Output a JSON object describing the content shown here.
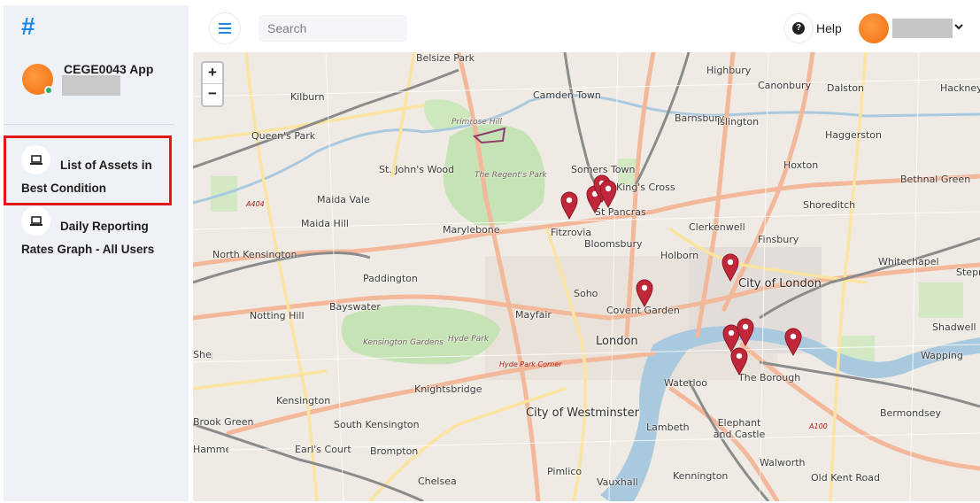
{
  "app": {
    "logo_glyph": "#",
    "title": "CEGE0043 App",
    "brand_color": "#1e88e5",
    "avatar_color": "#f57c1f",
    "status_color": "#27ae60"
  },
  "sidebar": {
    "items": [
      {
        "label": "List of Assets in Best Condition",
        "icon": "laptop-icon",
        "highlighted": true
      },
      {
        "label": "Daily Reporting Rates Graph - All Users",
        "icon": "laptop-icon",
        "highlighted": false
      }
    ],
    "highlight_color": "#e0181b"
  },
  "header": {
    "menu_icon": "hamburger-icon",
    "search": {
      "placeholder": "Search",
      "value": ""
    },
    "help": {
      "label": "Help",
      "icon": "question-circle-icon"
    },
    "user_menu_icon": "chevron-down-icon"
  },
  "map": {
    "zoom_in": "+",
    "zoom_out": "−",
    "places": [
      "Belsize Park",
      "Highbury",
      "Canonbury",
      "Dalston",
      "Hackney",
      "Kilburn",
      "Camden Town",
      "Primrose Hill",
      "Barnsbury",
      "Islington",
      "Queen's Park",
      "Haggerston",
      "St. John's Wood",
      "The Regent's Park",
      "Somers Town",
      "King's Cross",
      "Hoxton",
      "Bethnal Green",
      "Maida Vale",
      "A404",
      "Maida Hill",
      "St Pancras",
      "Shoreditch",
      "Marylebone",
      "Fitzrovia",
      "Clerkenwell",
      "Finsbury",
      "North Kensington",
      "Bloomsbury",
      "Holborn",
      "Whitechapel",
      "Paddington",
      "City of London",
      "Stepney",
      "Soho",
      "Notting Hill",
      "Bayswater",
      "Covent Garden",
      "Mayfair",
      "Kensington Gardens",
      "Hyde Park",
      "London",
      "Shadwell",
      "Hyde Park Corner",
      "Wapping",
      "Knightsbridge",
      "Waterloo",
      "The Borough",
      "Kensington",
      "City of Westminster",
      "Bermondsey",
      "Brook Green",
      "South Kensington",
      "Lambeth",
      "Elephant and Castle",
      "Earl's Court",
      "Brompton",
      "Walworth",
      "Chelsea",
      "Pimlico",
      "Vauxhall",
      "Kennington",
      "Old Kent Road",
      "A100",
      "Shepherd's Bush",
      "Hammersmith"
    ],
    "marker_color": "#c0283a",
    "marker_count": 10
  }
}
